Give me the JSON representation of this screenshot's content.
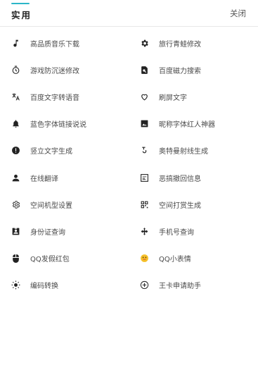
{
  "header": {
    "tab_label": "实用",
    "close_label": "关闭",
    "accent_color": "#2cb6c8"
  },
  "rows": [
    {
      "left": {
        "label": "高品质音乐下载",
        "icon": "music-note-icon"
      },
      "right": {
        "label": "旅行青蛙修改",
        "icon": "gear-icon"
      }
    },
    {
      "left": {
        "label": "游戏防沉迷修改",
        "icon": "timer-icon"
      },
      "right": {
        "label": "百度磁力搜索",
        "icon": "document-search-icon"
      }
    },
    {
      "left": {
        "label": "百度文字转语音",
        "icon": "translate-icon"
      },
      "right": {
        "label": "刷屏文字",
        "icon": "heart-outline-icon"
      }
    },
    {
      "left": {
        "label": "蓝色字体链接说说",
        "icon": "bell-icon"
      },
      "right": {
        "label": "昵称字体红人神器",
        "icon": "image-icon"
      }
    },
    {
      "left": {
        "label": "竖立文字生成",
        "icon": "alert-circle-icon"
      },
      "right": {
        "label": "奥特曼射线生成",
        "icon": "swirl-icon"
      }
    },
    {
      "left": {
        "label": "在线翻译",
        "icon": "person-icon"
      },
      "right": {
        "label": "恶搞撤回信息",
        "icon": "message-box-icon"
      }
    },
    {
      "left": {
        "label": "空间机型设置",
        "icon": "settings-outline-icon"
      },
      "right": {
        "label": "空间打赏生成",
        "icon": "qr-code-icon"
      }
    },
    {
      "left": {
        "label": "身份证查询",
        "icon": "id-card-icon"
      },
      "right": {
        "label": "手机号查询",
        "icon": "directions-icon"
      }
    },
    {
      "left": {
        "label": "QQ发假红包",
        "icon": "mouse-icon"
      },
      "right": {
        "label": "QQ小表情",
        "icon": "emoji-icon"
      }
    },
    {
      "left": {
        "label": "编码转换",
        "icon": "sun-icon"
      },
      "right": {
        "label": "王卡申请助手",
        "icon": "plus-circle-icon"
      }
    }
  ]
}
